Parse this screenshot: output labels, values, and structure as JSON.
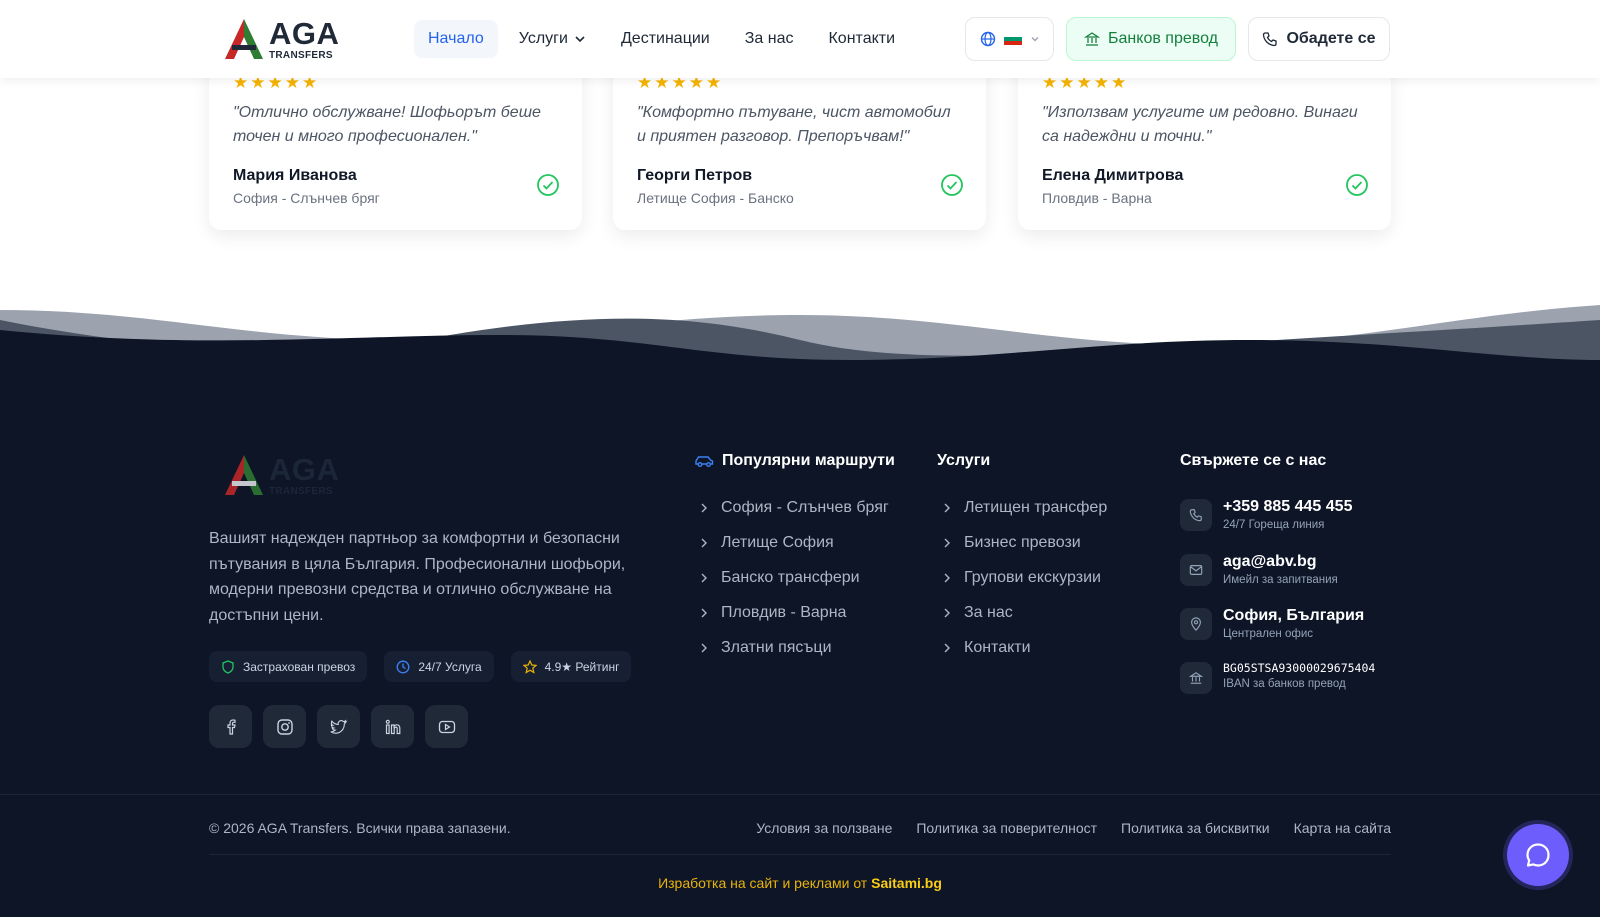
{
  "header": {
    "logo_title": "AGA",
    "logo_subtitle": "TRANSFERS",
    "nav": [
      {
        "label": "Начало",
        "active": true
      },
      {
        "label": "Услуги",
        "dropdown": true
      },
      {
        "label": "Дестинации"
      },
      {
        "label": "За нас"
      },
      {
        "label": "Контакти"
      }
    ],
    "bank_label": "Банков превод",
    "call_label": "Обадете се",
    "colors": {
      "accent": "#2563eb",
      "bank_green": "#15803d"
    }
  },
  "testimonials": [
    {
      "stars": "★★★★★",
      "quote": "\"Отлично обслужване! Шофьорът беше точен и много професионален.\"",
      "author": "Мария Иванова",
      "route": "София - Слънчев бряг"
    },
    {
      "stars": "★★★★★",
      "quote": "\"Комфортно пътуване, чист автомобил и приятен разговор. Препоръчвам!\"",
      "author": "Георги Петров",
      "route": "Летище София - Банско"
    },
    {
      "stars": "★★★★★",
      "quote": "\"Използвам услугите им редовно. Винаги са надеждни и точни.\"",
      "author": "Елена Димитрова",
      "route": "Пловдив - Варна"
    }
  ],
  "footer": {
    "description": "Вашият надежден партньор за комфортни и безопасни пътувания в цяла България. Професионални шофьори, модерни превозни средства и отлично обслужване на достъпни цени.",
    "badges": [
      "Застрахован превоз",
      "24/7 Услуга",
      "4.9★ Рейтинг"
    ],
    "socials": [
      "facebook-icon",
      "instagram-icon",
      "twitter-icon",
      "linkedin-icon",
      "youtube-icon"
    ],
    "routes_title": "Популярни маршрути",
    "routes": [
      "София - Слънчев бряг",
      "Летище София",
      "Банско трансфери",
      "Пловдив - Варна",
      "Златни пясъци"
    ],
    "services_title": "Услуги",
    "services": [
      "Летищен трансфер",
      "Бизнес превози",
      "Групови екскурзии",
      "За нас",
      "Контакти"
    ],
    "contact_title": "Свържете се с нас",
    "contacts": [
      {
        "main": "+359 885 445 455",
        "sub": "24/7 Гореща линия"
      },
      {
        "main": "aga@abv.bg",
        "sub": "Имейл за запитвания"
      },
      {
        "main": "София, България",
        "sub": "Централен офис"
      },
      {
        "main": "BG05STSA93000029675404",
        "sub": "IBAN за банков превод"
      }
    ],
    "copyright": "© 2026 AGA Transfers. Всички права запазени.",
    "legal": [
      "Условия за ползване",
      "Политика за поверителност",
      "Политика за бисквитки",
      "Карта на сайта"
    ],
    "credit_prefix": "Изработка на сайт и реклами от",
    "credit_brand": "Saitami.bg",
    "colors": {
      "background": "#0d1526",
      "credit": "#eab308",
      "chat": "#6d5dfc"
    }
  }
}
